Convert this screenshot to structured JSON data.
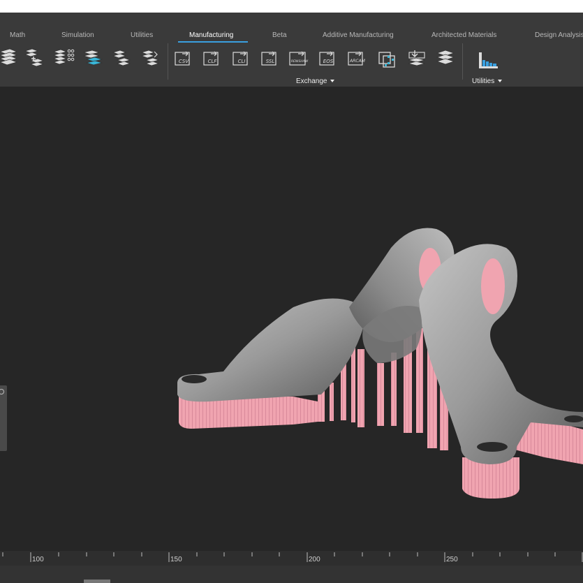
{
  "tabs": [
    {
      "label": "Math",
      "active": false
    },
    {
      "label": "Simulation",
      "active": false
    },
    {
      "label": "Utilities",
      "active": false
    },
    {
      "label": "Manufacturing",
      "active": true
    },
    {
      "label": "Beta",
      "active": false
    },
    {
      "label": "Additive Manufacturing",
      "active": false
    },
    {
      "label": "Architected Materials",
      "active": false
    },
    {
      "label": "Design Analysis",
      "active": false
    }
  ],
  "ribbon": {
    "slice_tools": [
      "slice-stack-icon",
      "slice-add-icon",
      "slice-points-icon",
      "slice-highlight-icon",
      "slice-layers-icon",
      "slice-merge-icon"
    ],
    "exchange_icons": [
      {
        "name": "export-csv-icon",
        "text": "CSV"
      },
      {
        "name": "export-clf-icon",
        "text": "CLF"
      },
      {
        "name": "export-cli-icon",
        "text": "CLI"
      },
      {
        "name": "export-ssl-icon",
        "text": "SSL"
      },
      {
        "name": "export-renishaw-icon",
        "text": "RENISHAW"
      },
      {
        "name": "export-eos-icon",
        "text": "EOS"
      },
      {
        "name": "export-arcam-icon",
        "text": "ARCAM"
      },
      {
        "name": "export-3d-icon",
        "text": ""
      },
      {
        "name": "import-slices-icon",
        "text": ""
      },
      {
        "name": "layers-icon",
        "text": ""
      }
    ],
    "exchange_label": "Exchange",
    "utilities_label": "Utilities",
    "utilities_icon": "bar-histogram-icon"
  },
  "ruler": {
    "labels": [
      "100",
      "150",
      "200",
      "250"
    ]
  },
  "colors": {
    "accent": "#3aa0e0",
    "support": "#f0a4b0",
    "model": "#9a9a9a",
    "background": "#262626"
  }
}
